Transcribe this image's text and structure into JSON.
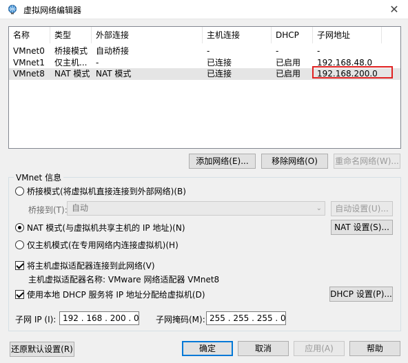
{
  "window": {
    "title": "虚拟网络编辑器",
    "icon": "globe-network-icon",
    "close": "✕"
  },
  "list": {
    "columns": [
      "名称",
      "类型",
      "外部连接",
      "主机连接",
      "DHCP",
      "子网地址"
    ],
    "rows": [
      [
        "VMnet0",
        "桥接模式",
        "自动桥接",
        "-",
        "-",
        "-"
      ],
      [
        "VMnet1",
        "仅主机...",
        "-",
        "已连接",
        "已启用",
        "192.168.48.0"
      ],
      [
        "VMnet8",
        "NAT 模式",
        "NAT 模式",
        "已连接",
        "已启用",
        "192.168.200.0"
      ]
    ],
    "selected_row": 2
  },
  "list_buttons": {
    "add": "添加网络(E)...",
    "remove": "移除网络(O)",
    "rename": "重命名网络(W)..."
  },
  "vmnet_info": {
    "group_label": "VMnet 信息",
    "bridged_radio": "桥接模式(将虚拟机直接连接到外部网络)(B)",
    "bridged_to_label": "桥接到(T):",
    "bridged_to_value": "自动",
    "auto_settings": "自动设置(U)...",
    "nat_radio": "NAT 模式(与虚拟机共享主机的 IP 地址)(N)",
    "nat_settings": "NAT 设置(S)...",
    "hostonly_radio": "仅主机模式(在专用网络内连接虚拟机)(H)",
    "connect_adapter_check": "将主机虚拟适配器连接到此网络(V)",
    "adapter_name": "主机虚拟适配器名称: VMware 网络适配器 VMnet8",
    "dhcp_check": "使用本地 DHCP 服务将 IP 地址分配给虚拟机(D)",
    "dhcp_settings": "DHCP 设置(P)...",
    "subnet_ip_label": "子网 IP (I):",
    "subnet_ip_value": "192 . 168 . 200 .  0",
    "subnet_mask_label": "子网掩码(M):",
    "subnet_mask_value": "255 . 255 . 255 .  0"
  },
  "footer": {
    "restore": "还原默认设置(R)",
    "ok": "确定",
    "cancel": "取消",
    "apply": "应用(A)",
    "help": "帮助"
  },
  "colors": {
    "highlight": "#e02020",
    "default_button_border": "#0078d7"
  }
}
